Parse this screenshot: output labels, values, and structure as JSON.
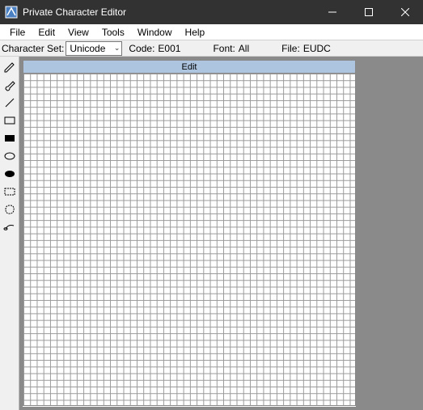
{
  "window": {
    "title": "Private Character Editor"
  },
  "menu": {
    "file": "File",
    "edit": "Edit",
    "view": "View",
    "tools": "Tools",
    "window": "Window",
    "help": "Help"
  },
  "infobar": {
    "charset_label": "Character Set:",
    "charset_value": "Unicode",
    "code_label": "Code:",
    "code_value": "E001",
    "font_label": "Font:",
    "font_value": "All",
    "file_label": "File:",
    "file_value": "EUDC"
  },
  "canvas": {
    "header": "Edit"
  }
}
